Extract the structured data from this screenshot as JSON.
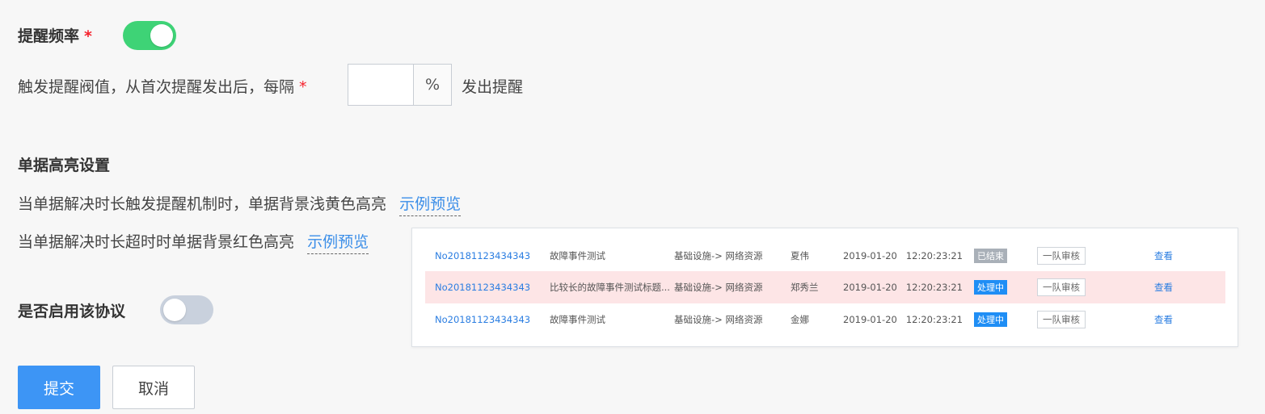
{
  "reminder": {
    "frequency_label": "提醒频率",
    "required_mark": "*",
    "threshold_prefix": "触发提醒阀值，从首次提醒发出后，每隔",
    "threshold_value": "",
    "threshold_unit": "%",
    "threshold_suffix": "发出提醒",
    "toggle_on": true
  },
  "highlight": {
    "section_title": "单据高亮设置",
    "yellow_text": "当单据解决时长触发提醒机制时，单据背景浅黄色高亮",
    "yellow_link": "示例预览",
    "red_text": "当单据解决时长超时时单据背景红色高亮",
    "red_link": "示例预览"
  },
  "preview": {
    "rows": [
      {
        "id": "No20181123434343",
        "title": "故障事件测试",
        "category": "基础设施-> 网络资源",
        "user": "夏伟",
        "date": "2019-01-20",
        "time": "12:20:23:21",
        "status": "已结束",
        "status_type": "done",
        "stage": "一队审核",
        "action": "查看",
        "highlight": "none"
      },
      {
        "id": "No20181123434343",
        "title": "比较长的故障事件测试标题...",
        "category": "基础设施-> 网络资源",
        "user": "郑秀兰",
        "date": "2019-01-20",
        "time": "12:20:23:21",
        "status": "处理中",
        "status_type": "proc",
        "stage": "一队审核",
        "action": "查看",
        "highlight": "red"
      },
      {
        "id": "No20181123434343",
        "title": "故障事件测试",
        "category": "基础设施-> 网络资源",
        "user": "金娜",
        "date": "2019-01-20",
        "time": "12:20:23:21",
        "status": "处理中",
        "status_type": "proc",
        "stage": "一队审核",
        "action": "查看",
        "highlight": "none"
      }
    ]
  },
  "protocol": {
    "enable_label": "是否启用该协议",
    "toggle_on": false
  },
  "actions": {
    "submit_label": "提交",
    "cancel_label": "取消"
  },
  "colors": {
    "accent": "#3d95f5",
    "toggle_on": "#3ed376",
    "toggle_off": "#c9d1dd",
    "red_highlight": "#fde5e6"
  }
}
